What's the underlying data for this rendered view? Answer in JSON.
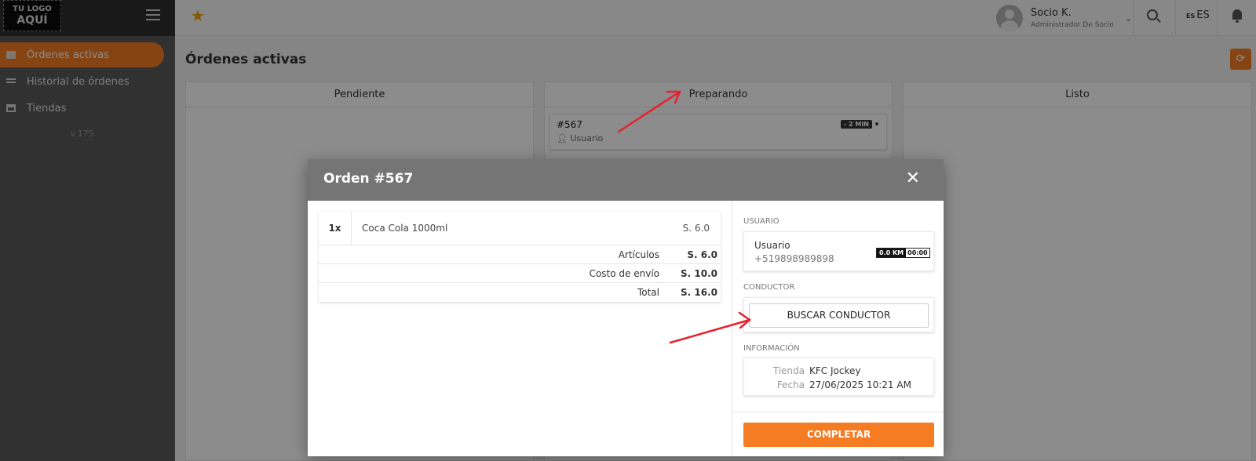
{
  "brand": {
    "logo_line1": "TU LOGO",
    "logo_line2": "AQUÍ"
  },
  "sidebar": {
    "items": [
      {
        "label": "Órdenes activas",
        "active": true
      },
      {
        "label": "Historial de órdenes",
        "active": false
      },
      {
        "label": "Tiendas",
        "active": false
      }
    ],
    "version": "v.175"
  },
  "topbar": {
    "user_name": "Socio K.",
    "user_role": "Administrador De Socio",
    "lang_flag": "ES",
    "lang_label": "ES"
  },
  "page": {
    "title": "Órdenes activas",
    "columns": [
      {
        "title": "Pendiente"
      },
      {
        "title": "Preparando"
      },
      {
        "title": "Listo"
      }
    ],
    "card": {
      "number": "#567",
      "user": "Usuario",
      "time_badge": "- 2 MIN"
    }
  },
  "modal": {
    "title": "Orden #567",
    "items": [
      {
        "qty": "1x",
        "name": "Coca Cola 1000ml",
        "price": "S. 6.0"
      }
    ],
    "summary": [
      {
        "label": "Artículos",
        "value": "S. 6.0"
      },
      {
        "label": "Costo de envío",
        "value": "S. 10.0"
      },
      {
        "label": "Total",
        "value": "S. 16.0"
      }
    ],
    "user_section": "USUARIO",
    "user": {
      "name": "Usuario",
      "phone": "+519898989898",
      "distance": "0.0 KM",
      "time": "00:00"
    },
    "driver_section": "CONDUCTOR",
    "find_driver_label": "BUSCAR CONDUCTOR",
    "info_section": "INFORMACIÓN",
    "info": [
      {
        "key": "Tienda",
        "value": "KFC Jockey"
      },
      {
        "key": "Fecha",
        "value": "27/06/2025 10:21 AM"
      }
    ],
    "complete_label": "COMPLETAR"
  },
  "colors": {
    "accent": "#f57c22",
    "annotation": "#e8202f"
  }
}
